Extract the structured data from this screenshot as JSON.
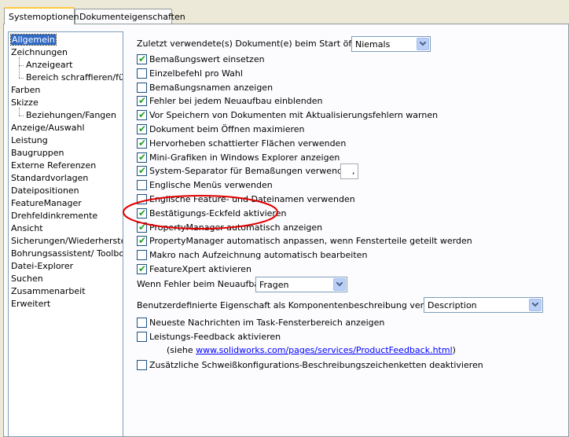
{
  "tabs": [
    {
      "label": "Systemoptionen",
      "active": true
    },
    {
      "label": "Dokumenteigenschaften",
      "active": false
    }
  ],
  "tree": [
    {
      "label": "Allgemein",
      "level": 0,
      "selected": true
    },
    {
      "label": "Zeichnungen",
      "level": 0
    },
    {
      "label": "Anzeigeart",
      "level": 1
    },
    {
      "label": "Bereich schraffieren/füllen",
      "level": 1
    },
    {
      "label": "Farben",
      "level": 0
    },
    {
      "label": "Skizze",
      "level": 0
    },
    {
      "label": "Beziehungen/Fangen",
      "level": 1
    },
    {
      "label": "Anzeige/Auswahl",
      "level": 0
    },
    {
      "label": "Leistung",
      "level": 0
    },
    {
      "label": "Baugruppen",
      "level": 0
    },
    {
      "label": "Externe Referenzen",
      "level": 0
    },
    {
      "label": "Standardvorlagen",
      "level": 0
    },
    {
      "label": "Dateipositionen",
      "level": 0
    },
    {
      "label": "FeatureManager",
      "level": 0
    },
    {
      "label": "Drehfeldinkremente",
      "level": 0
    },
    {
      "label": "Ansicht",
      "level": 0
    },
    {
      "label": "Sicherungen/Wiederherstellen",
      "level": 0
    },
    {
      "label": "Bohrungsassistent/ Toolbox",
      "level": 0
    },
    {
      "label": "Datei-Explorer",
      "level": 0
    },
    {
      "label": "Suchen",
      "level": 0
    },
    {
      "label": "Zusammenarbeit",
      "level": 0
    },
    {
      "label": "Erweitert",
      "level": 0
    }
  ],
  "open_last_docs": {
    "label": "Zuletzt verwendete(s) Dokument(e) beim Start öffnen:",
    "value": "Niemals"
  },
  "options": [
    {
      "label": "Bemaßungswert einsetzen",
      "checked": true
    },
    {
      "label": "Einzelbefehl pro Wahl",
      "checked": false
    },
    {
      "label": "Bemaßungsnamen anzeigen",
      "checked": false
    },
    {
      "label": "Fehler bei jedem Neuaufbau einblenden",
      "checked": true
    },
    {
      "label": "Vor Speichern von Dokumenten mit Aktualisierungsfehlern warnen",
      "checked": true
    },
    {
      "label": "Dokument beim Öffnen maximieren",
      "checked": true
    },
    {
      "label": "Hervorheben schattierter Flächen verwenden",
      "checked": true
    },
    {
      "label": "Mini-Grafiken in Windows Explorer anzeigen",
      "checked": true
    },
    {
      "label": "System-Separator für Bemaßungen verwenden",
      "checked": true
    },
    {
      "label": "Englische Menüs verwenden",
      "checked": false
    },
    {
      "label": "Englische Feature- und Dateinamen verwenden",
      "checked": false
    },
    {
      "label": "Bestätigungs-Eckfeld aktivieren",
      "checked": true
    },
    {
      "label": "PropertyManager automatisch anzeigen",
      "checked": true
    },
    {
      "label": "PropertyManager automatisch anpassen, wenn Fensterteile geteilt werden",
      "checked": true
    },
    {
      "label": "Makro nach Aufzeichnung automatisch bearbeiten",
      "checked": false
    },
    {
      "label": "FeatureXpert aktivieren",
      "checked": true
    }
  ],
  "separator_value": ",",
  "rebuild_error": {
    "label": "Wenn Fehler beim Neuaufbau:",
    "value": "Fragen"
  },
  "custom_property": {
    "label": "Benutzerdefinierte Eigenschaft als Komponentenbeschreibung verwendet:",
    "value": "Description"
  },
  "bottom_options": [
    {
      "label": "Neueste Nachrichten im Task-Fensterbereich anzeigen",
      "checked": false
    },
    {
      "label": "Leistungs-Feedback aktivieren",
      "checked": false
    }
  ],
  "feedback_note": {
    "prefix": "(siehe ",
    "link": "www.solidworks.com/pages/services/ProductFeedback.html",
    "suffix": ")"
  },
  "last_option": {
    "label": "Zusätzliche Schweißkonfigurations-Beschreibungszeichenketten deaktivieren",
    "checked": false
  },
  "annotation_color": "#E00000"
}
